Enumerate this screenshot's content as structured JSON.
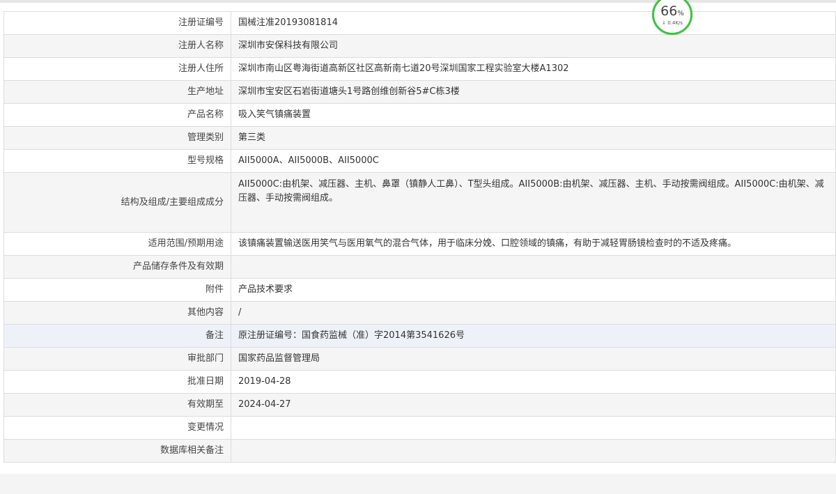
{
  "speed_widget": {
    "percent": "66",
    "percent_unit": "%",
    "rate_arrow": "↓",
    "rate": "0.4K/s"
  },
  "rows": [
    {
      "label": "注册证编号",
      "value": "国械注准20193081814"
    },
    {
      "label": "注册人名称",
      "value": "深圳市安保科技有限公司"
    },
    {
      "label": "注册人住所",
      "value": "深圳市南山区粤海街道高新区社区高新南七道20号深圳国家工程实验室大楼A1302"
    },
    {
      "label": "生产地址",
      "value": "深圳市宝安区石岩街道塘头1号路创维创新谷5#C栋3楼"
    },
    {
      "label": "产品名称",
      "value": "吸入笑气镇痛装置"
    },
    {
      "label": "管理类别",
      "value": "第三类"
    },
    {
      "label": "型号规格",
      "value": "AII5000A、AII5000B、AII5000C"
    },
    {
      "label": "结构及组成/主要组成成分",
      "value": "AII5000C:由机架、减压器、主机、鼻罩（镇静人工鼻）、T型头组成。AII5000B:由机架、减压器、主机、手动按需阀组成。AII5000C:由机架、减压器、手动按需阀组成。"
    },
    {
      "label": "适用范围/预期用途",
      "value": "该镇痛装置输送医用笑气与医用氧气的混合气体，用于临床分娩、口腔领域的镇痛，有助于减轻胃肠镜检查时的不适及疼痛。"
    },
    {
      "label": "产品储存条件及有效期",
      "value": ""
    },
    {
      "label": "附件",
      "value": "产品技术要求"
    },
    {
      "label": "其他内容",
      "value": "/"
    },
    {
      "label": "备注",
      "value": "原注册证编号：国食药监械（准）字2014第3541626号"
    },
    {
      "label": "审批部门",
      "value": "国家药品监督管理局"
    },
    {
      "label": "批准日期",
      "value": "2019-04-28"
    },
    {
      "label": "有效期至",
      "value": "2024-04-27"
    },
    {
      "label": "变更情况",
      "value": ""
    },
    {
      "label": "数据库相关备注",
      "value": ""
    }
  ]
}
